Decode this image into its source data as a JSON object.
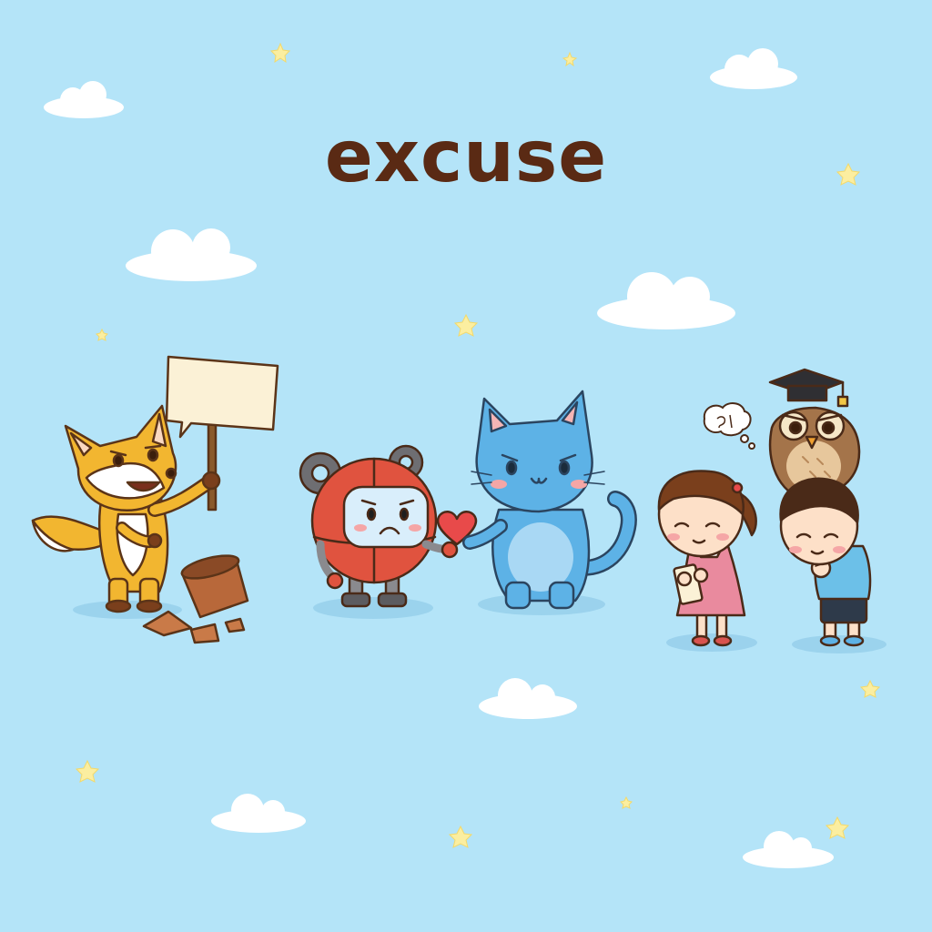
{
  "word": "excuse",
  "colors": {
    "sky": "#b4e4f8",
    "title": "#5a2a14",
    "cloud": "#ffffff",
    "star": "#fbeea0",
    "shadow": "#93cdea",
    "fox": "#f2b630",
    "robot": "#e0533f",
    "cat": "#5db2e6",
    "owl": "#a4744a"
  },
  "characters": [
    {
      "name": "fox",
      "icon": "fox-holding-sign-icon"
    },
    {
      "name": "robot",
      "icon": "robot-with-gears-icon"
    },
    {
      "name": "cat",
      "icon": "blue-cat-icon"
    },
    {
      "name": "girl",
      "icon": "girl-with-note-icon"
    },
    {
      "name": "owl",
      "icon": "owl-graduation-cap-icon"
    },
    {
      "name": "boy",
      "icon": "boy-apologizing-icon"
    }
  ]
}
